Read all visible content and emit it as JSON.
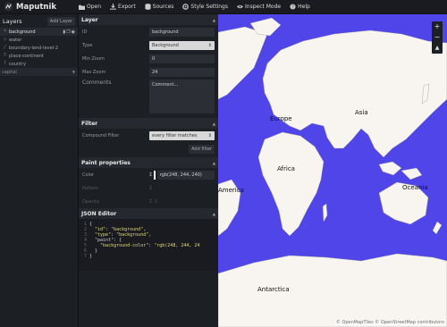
{
  "app": {
    "name": "Maputnik"
  },
  "toolbar": {
    "items": [
      {
        "label": "Open",
        "icon": "folder-icon"
      },
      {
        "label": "Export",
        "icon": "download-icon"
      },
      {
        "label": "Sources",
        "icon": "database-icon"
      },
      {
        "label": "Style Settings",
        "icon": "settings-icon"
      },
      {
        "label": "Inspect Mode",
        "icon": "eye-icon"
      },
      {
        "label": "Help",
        "icon": "help-icon"
      }
    ]
  },
  "layers": {
    "title": "Layers",
    "add_label": "Add Layer",
    "items": [
      {
        "name": "background",
        "active": true
      },
      {
        "name": "water"
      },
      {
        "name": "boundary-land-level-2"
      },
      {
        "name": "place-continent"
      },
      {
        "name": "country"
      }
    ],
    "group": "capital"
  },
  "editor": {
    "layer_section": "Layer",
    "id_label": "ID",
    "id_value": "background",
    "type_label": "Type",
    "type_value": "Background",
    "minzoom_label": "Min Zoom",
    "minzoom_value": "0",
    "maxzoom_label": "Max Zoom",
    "maxzoom_value": "24",
    "comments_label": "Comments",
    "comments_placeholder": "Comment...",
    "filter_section": "Filter",
    "compound_label": "Compound Filter",
    "compound_value": "every filter matches",
    "add_filter_label": "Add filter",
    "paint_section": "Paint properties",
    "color_label": "Color",
    "color_value": "rgb(248, 244, 240)",
    "pattern_label": "Pattern",
    "opacity_label": "Opacity",
    "opacity_value": "1",
    "json_section": "JSON Editor",
    "json_lines": [
      "{",
      "  \"id\": \"background\",",
      "  \"type\": \"background\",",
      "  \"paint\": {",
      "    \"background-color\": \"rgb(248, 244, 24",
      "  }",
      "}"
    ]
  },
  "map": {
    "labels": {
      "europe": "Europe",
      "asia": "Asia",
      "africa": "Africa",
      "america": "America",
      "oceania": "Oceania",
      "antarctica": "Antarctica"
    },
    "zoom_in": "+",
    "zoom_out": "−",
    "attribution": "© OpenMapTiles © OpenStreetMap contributors",
    "colors": {
      "water": "#4f45e8",
      "land": "#f8f4f0",
      "border": "#9a9a9a"
    }
  }
}
